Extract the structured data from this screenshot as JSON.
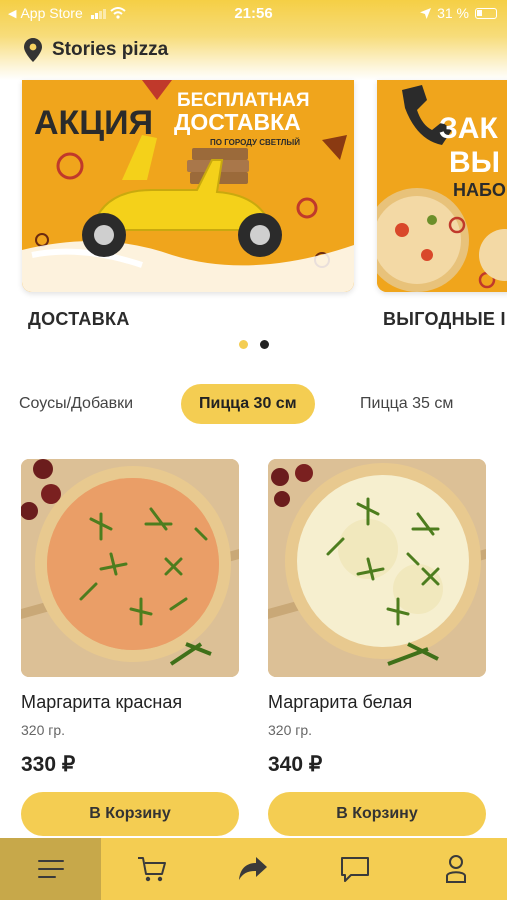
{
  "status_bar": {
    "carrier": "App Store",
    "time": "21:56",
    "battery": "31 %"
  },
  "header": {
    "location_name": "Stories pizza"
  },
  "banners": [
    {
      "label": "ДОСТАВКА",
      "promo_text_1": "АКЦИЯ",
      "promo_text_2": "БЕСПЛАТНАЯ",
      "promo_text_3": "ДОСТАВКА",
      "promo_text_4": "ПО ГОРОДУ СВЕТЛЫЙ"
    },
    {
      "label": "ВЫГОДНЫЕ І",
      "promo_text_1": "ЗАК",
      "promo_text_2": "ВЫ",
      "promo_text_3": "НАБОР"
    }
  ],
  "pagination": {
    "active_color": "#f4cd52",
    "inactive_color": "#222222"
  },
  "categories": [
    {
      "label": "Соусы/Добавки",
      "active": false
    },
    {
      "label": "Пицца 30 см",
      "active": true
    },
    {
      "label": "Пицца 35 см",
      "active": false
    }
  ],
  "products": [
    {
      "name": "Маргарита красная",
      "weight": "320 гр.",
      "price": "330 ₽",
      "button": "В Корзину"
    },
    {
      "name": "Маргарита белая",
      "weight": "320 гр.",
      "price": "340 ₽",
      "button": "В Корзину"
    }
  ],
  "tabbar": {
    "items": [
      "menu-icon",
      "cart-icon",
      "share-icon",
      "chat-icon",
      "profile-icon"
    ],
    "accent": "#f4cd52"
  }
}
